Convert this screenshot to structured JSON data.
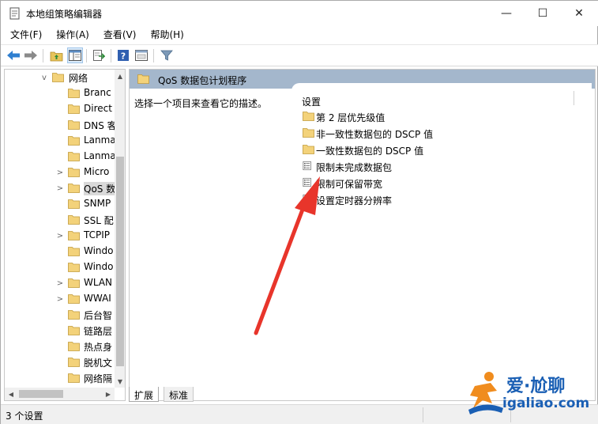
{
  "window": {
    "title": "本地组策略编辑器",
    "icon": "policy-editor-icon"
  },
  "controls": {
    "minimize": "—",
    "maximize": "☐",
    "close": "✕"
  },
  "menu": {
    "items": [
      {
        "label": "文件(F)"
      },
      {
        "label": "操作(A)"
      },
      {
        "label": "查看(V)"
      },
      {
        "label": "帮助(H)"
      }
    ]
  },
  "toolbar": {
    "buttons": [
      "back-arrow-icon",
      "forward-arrow-icon",
      "up-folder-icon",
      "show-hide-tree-icon",
      "export-list-icon",
      "help-icon",
      "properties-icon",
      "filter-icon"
    ]
  },
  "tree": {
    "items": [
      {
        "label": "网络",
        "expander": "v"
      },
      {
        "label": "Branc",
        "expander": ""
      },
      {
        "label": "Direct",
        "expander": ""
      },
      {
        "label": "DNS 客",
        "expander": ""
      },
      {
        "label": "Lanma",
        "expander": ""
      },
      {
        "label": "Lanma",
        "expander": ""
      },
      {
        "label": "Micro",
        "expander": ">"
      },
      {
        "label": "QoS 数",
        "expander": ">",
        "selected": true
      },
      {
        "label": "SNMP",
        "expander": ""
      },
      {
        "label": "SSL 配",
        "expander": ""
      },
      {
        "label": "TCPIP",
        "expander": ">"
      },
      {
        "label": "Windo",
        "expander": ""
      },
      {
        "label": "Windo",
        "expander": ""
      },
      {
        "label": "WLAN",
        "expander": ">"
      },
      {
        "label": "WWAI",
        "expander": ">"
      },
      {
        "label": "后台智",
        "expander": ""
      },
      {
        "label": "链路层",
        "expander": ""
      },
      {
        "label": "热点身",
        "expander": ""
      },
      {
        "label": "脱机文",
        "expander": ""
      },
      {
        "label": "网络隔",
        "expander": ""
      }
    ]
  },
  "content": {
    "header_title": "QoS 数据包计划程序",
    "description": "选择一个项目来查看它的描述。",
    "column_header": "设置",
    "rows": [
      {
        "label": "第 2 层优先级值",
        "icon": "folder-icon"
      },
      {
        "label": "非一致性数据包的 DSCP 值",
        "icon": "folder-icon"
      },
      {
        "label": "一致性数据包的 DSCP 值",
        "icon": "folder-icon"
      },
      {
        "label": "限制未完成数据包",
        "icon": "policy-setting-icon"
      },
      {
        "label": "限制可保留带宽",
        "icon": "policy-setting-icon"
      },
      {
        "label": "设置定时器分辨率",
        "icon": "policy-setting-icon"
      }
    ]
  },
  "tabs": {
    "expand": "扩展",
    "standard": "标准"
  },
  "status": {
    "text": "3 个设置"
  },
  "watermark": {
    "cn": "爱·尬聊",
    "en": "igaliao.com"
  },
  "colors": {
    "header_bg": "#a4b7cc",
    "arrow_red": "#e8352b",
    "folder": "#e8c45a",
    "watermark_blue": "#1a5fb4",
    "watermark_orange": "#f08c1e"
  }
}
